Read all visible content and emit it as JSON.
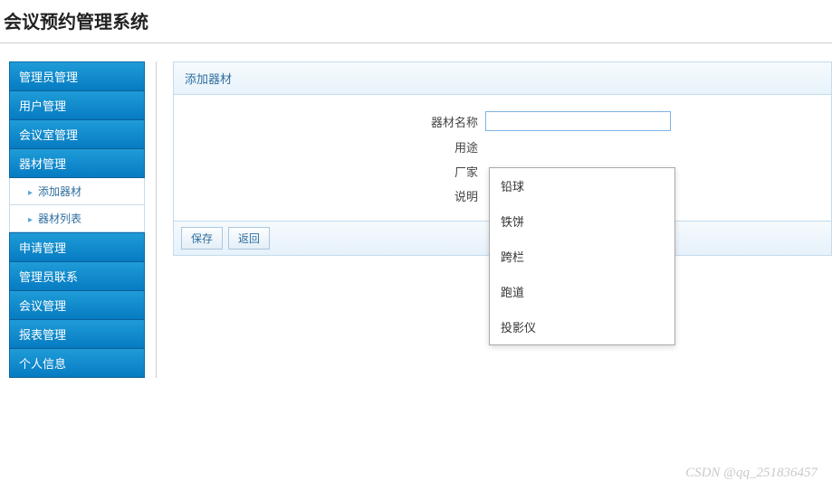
{
  "header": {
    "title": "会议预约管理系统"
  },
  "sidebar": {
    "items": [
      {
        "label": "管理员管理"
      },
      {
        "label": "用户管理"
      },
      {
        "label": "会议室管理"
      },
      {
        "label": "器材管理"
      },
      {
        "label": "申请管理"
      },
      {
        "label": "管理员联系"
      },
      {
        "label": "会议管理"
      },
      {
        "label": "报表管理"
      },
      {
        "label": "个人信息"
      }
    ],
    "submenu": {
      "items": [
        {
          "label": "添加器材"
        },
        {
          "label": "器材列表"
        }
      ]
    }
  },
  "panel": {
    "title": "添加器材",
    "form": {
      "name_label": "器材名称",
      "name_value": "",
      "purpose_label": "用途",
      "manufacturer_label": "厂家",
      "description_label": "说明"
    },
    "actions": {
      "save": "保存",
      "back": "返回"
    }
  },
  "autocomplete": {
    "options": [
      {
        "label": "铅球"
      },
      {
        "label": "铁饼"
      },
      {
        "label": "跨栏"
      },
      {
        "label": "跑道"
      },
      {
        "label": "投影仪"
      }
    ]
  },
  "watermark": "CSDN @qq_251836457"
}
